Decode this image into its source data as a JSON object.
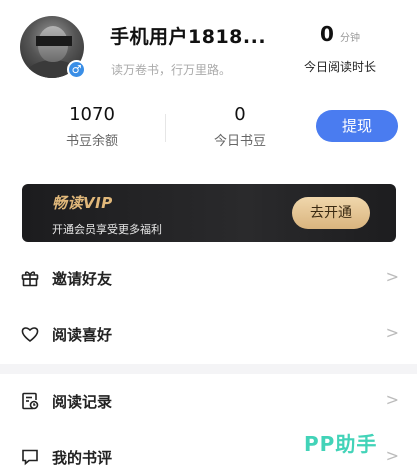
{
  "profile": {
    "nickname": "手机用户1818...",
    "motto": "读万卷书，行万里路。",
    "gender_symbol": "♂",
    "read_time": {
      "value": "0",
      "unit": "分钟",
      "label": "今日阅读时长"
    }
  },
  "stats": {
    "balance": {
      "value": "1070",
      "label": "书豆余额"
    },
    "today": {
      "value": "0",
      "label": "今日书豆"
    },
    "withdraw_label": "提现"
  },
  "vip": {
    "title": "畅读VIP",
    "subtitle": "开通会员享受更多福利",
    "button_label": "去开通"
  },
  "menu": {
    "items": [
      {
        "label": "邀请好友",
        "icon": "gift-icon"
      },
      {
        "label": "阅读喜好",
        "icon": "heart-icon"
      },
      {
        "label": "阅读记录",
        "icon": "history-icon"
      },
      {
        "label": "我的书评",
        "icon": "comment-icon"
      }
    ],
    "chevron": ">"
  },
  "watermark": "PP助手",
  "colors": {
    "accent": "#4a7cf0",
    "vip_gold": "#e1b87a",
    "vip_bg": "#1c1c1e",
    "watermark": "#42d3b8"
  }
}
